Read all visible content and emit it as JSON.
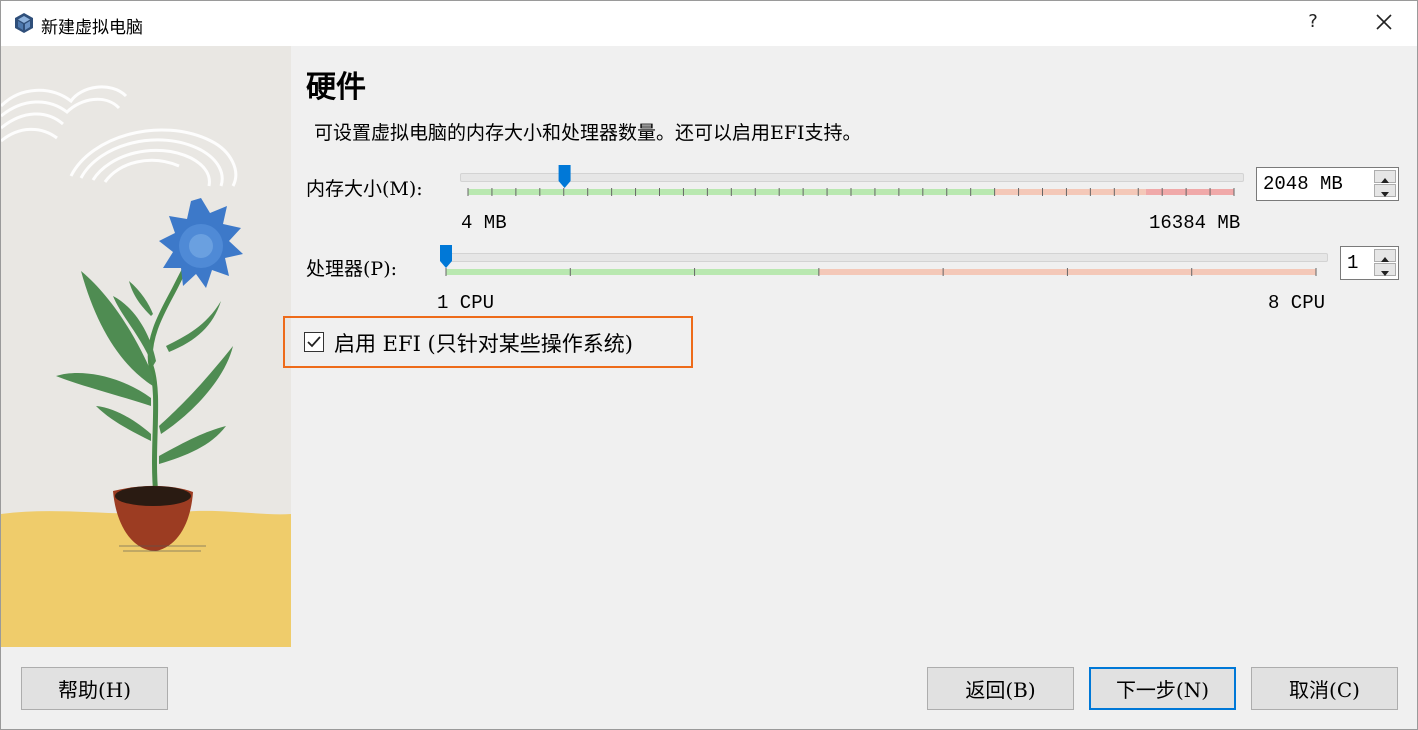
{
  "window": {
    "title": "新建虚拟电脑",
    "help_glyph": "?"
  },
  "page": {
    "heading": "硬件",
    "description": "可设置虚拟电脑的内存大小和处理器数量。还可以启用EFI支持。"
  },
  "memory": {
    "label": "内存大小(M):",
    "min_label": "4 MB",
    "max_label": "16384 MB",
    "value_text": "2048 MB",
    "min_mb": 4,
    "max_mb": 16384,
    "value_mb": 2048
  },
  "processor": {
    "label": "处理器(P):",
    "min_label": "1 CPU",
    "max_label": "8 CPU",
    "value_text": "1",
    "min": 1,
    "max": 8,
    "value": 1
  },
  "efi": {
    "label": "启用 EFI (只针对某些操作系统)",
    "checked": true
  },
  "buttons": {
    "help": "帮助(H)",
    "back": "返回(B)",
    "next": "下一步(N)",
    "cancel": "取消(C)"
  },
  "colors": {
    "accent": "#0078d7",
    "highlight": "#ee6b1a",
    "slider_ok": "#b9e8b0",
    "slider_warn": "#f4c8b8",
    "slider_bad": "#f0a9a9"
  }
}
